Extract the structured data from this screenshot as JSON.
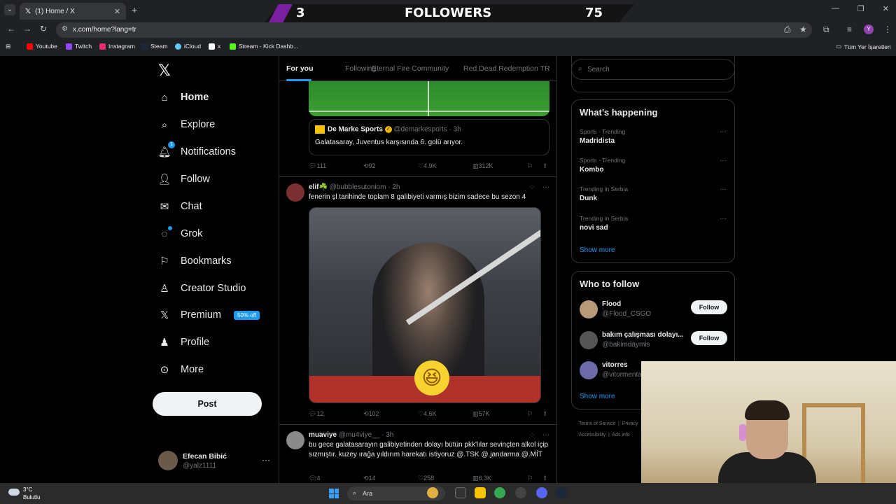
{
  "browser": {
    "tab_title": "(1) Home / X",
    "url": "x.com/home?lang=tr",
    "bookmarks": [
      "Youtube",
      "Twitch",
      "Instagram",
      "Steam",
      "iCloud",
      "x",
      "Stream - Kick Dashb..."
    ],
    "all_bookmarks": "Tüm Yer İşaretleri",
    "profile_initial": "Y"
  },
  "overlay": {
    "left_count": "3",
    "label": "FOLLOWERS",
    "right_count": "75"
  },
  "sidebar": {
    "items": [
      {
        "label": "Home"
      },
      {
        "label": "Explore"
      },
      {
        "label": "Notifications",
        "badge": "1"
      },
      {
        "label": "Follow"
      },
      {
        "label": "Chat"
      },
      {
        "label": "Grok"
      },
      {
        "label": "Bookmarks"
      },
      {
        "label": "Creator Studio"
      },
      {
        "label": "Premium",
        "promo": "50% off"
      },
      {
        "label": "Profile"
      },
      {
        "label": "More"
      }
    ],
    "post_label": "Post",
    "user": {
      "name": "Efecan Bibić",
      "handle": "@yalz1111"
    }
  },
  "timeline": {
    "tabs": [
      "For you",
      "Following",
      "Eternal Fire Community",
      "Red Dead Redemption TR"
    ],
    "quote": {
      "name": "De Marke Sports",
      "handle": "@demarkesports",
      "time": "· 3h",
      "text": "Galatasaray, Juventus karşısında 6. golü arıyor."
    },
    "tweet1_actions": {
      "replies": "111",
      "reposts": "92",
      "likes": "4.9K",
      "views": "312K"
    },
    "tweet2": {
      "name": "elif☘️",
      "handle": "@bubblesutoniom",
      "time": "· 2h",
      "text": "fenerin şl tarihinde toplam 8 galibiyeti varmış bizim sadece bu sezon 4",
      "actions": {
        "replies": "12",
        "reposts": "102",
        "likes": "4.6K",
        "views": "57K"
      }
    },
    "tweet3": {
      "name": "muaviye",
      "handle": "@mu4viye__",
      "time": "· 3h",
      "text": "bu gece galatasarayın galibiyetinden dolayı bütün pkk'lılar sevinçten alkol içip sızmıştır. kuzey ırağa yıldırım harekatı istiyoruz @.TSK @.jandarma @.MİT",
      "actions": {
        "replies": "4",
        "reposts": "14",
        "likes": "258",
        "views": "6.3K"
      }
    }
  },
  "right": {
    "search_placeholder": "Search",
    "happening_title": "What’s happening",
    "trends": [
      {
        "cat": "Sports · Trending",
        "name": "Madridista"
      },
      {
        "cat": "Sports · Trending",
        "name": "Kombo"
      },
      {
        "cat": "Trending in Serbia",
        "name": "Dunk"
      },
      {
        "cat": "Trending in Serbia",
        "name": "novi sad"
      }
    ],
    "show_more": "Show more",
    "wtf_title": "Who to follow",
    "wtf": [
      {
        "name": "Flood",
        "handle": "@Flood_CSGO",
        "button": "Follow"
      },
      {
        "name": "bakım çalışması dolayı...",
        "handle": "@bakimdaymis",
        "button": "Follow"
      },
      {
        "name": "vitorres",
        "handle": "@vitormenta"
      }
    ],
    "footer": [
      "Terms of Service",
      "Privacy",
      "Accessibility",
      "Ads info"
    ]
  },
  "taskbar": {
    "temp": "3°C",
    "weather": "Bulutlu",
    "search": "Ara"
  }
}
